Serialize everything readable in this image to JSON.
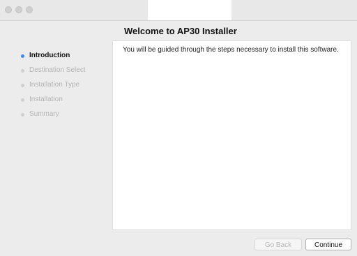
{
  "window": {
    "title": "Welcome to AP30 Installer"
  },
  "sidebar": {
    "steps": [
      {
        "label": "Introduction",
        "active": true
      },
      {
        "label": "Destination Select",
        "active": false
      },
      {
        "label": "Installation Type",
        "active": false
      },
      {
        "label": "Installation",
        "active": false
      },
      {
        "label": "Summary",
        "active": false
      }
    ]
  },
  "main": {
    "body": "You will be guided through the steps necessary to install this software."
  },
  "footer": {
    "back_label": "Go Back",
    "continue_label": "Continue"
  },
  "colors": {
    "active_dot": "#3b8be7",
    "inactive_text": "#b4b4b4"
  }
}
